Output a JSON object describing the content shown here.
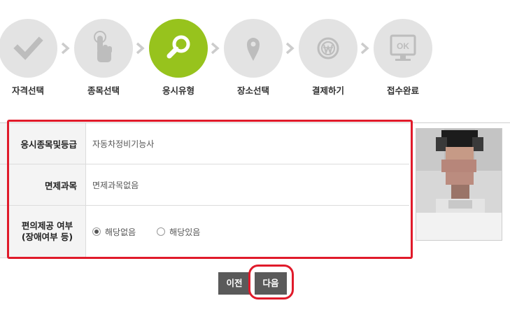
{
  "steps": [
    {
      "label": "자격선택",
      "icon": "check-icon",
      "active": false
    },
    {
      "label": "종목선택",
      "icon": "hand-pointer-icon",
      "active": false
    },
    {
      "label": "응시유형",
      "icon": "search-icon",
      "active": true
    },
    {
      "label": "장소선택",
      "icon": "map-pin-icon",
      "active": false
    },
    {
      "label": "결제하기",
      "icon": "won-coin-icon",
      "active": false
    },
    {
      "label": "접수완료",
      "icon": "ok-monitor-icon",
      "active": false
    }
  ],
  "form": {
    "rows": [
      {
        "label": "응시종목및등급",
        "value": "자동차정비기능사"
      },
      {
        "label": "면제과목",
        "value": "면제과목없음"
      },
      {
        "label_line1": "편의제공 여부",
        "label_line2": "(장애여부 등)"
      }
    ],
    "options": [
      {
        "label": "해당없음",
        "checked": true
      },
      {
        "label": "해당있음",
        "checked": false
      }
    ]
  },
  "buttons": {
    "prev": "이전",
    "next": "다음"
  },
  "colors": {
    "active_step": "#97c31d",
    "inactive_step": "#e3e3e3",
    "highlight": "#e01a2a",
    "button": "#5a5a5a"
  }
}
